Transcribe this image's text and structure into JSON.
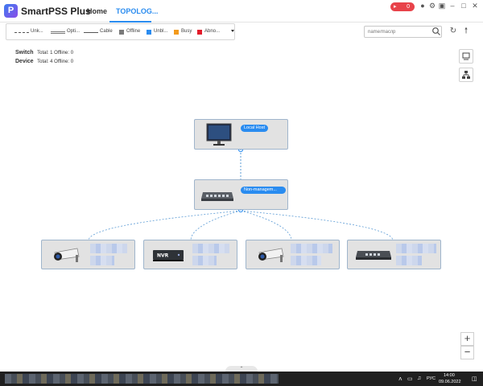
{
  "app": {
    "name": "SmartPSS Plus",
    "logo_letter": "P"
  },
  "tabs": [
    {
      "label": "Home"
    },
    {
      "label": "TOPOLOG..."
    }
  ],
  "titlebar": {
    "alarm_count": "0"
  },
  "legend": {
    "items": [
      "Unk...",
      "Opti...",
      "Cable",
      "Offline",
      "Unbl...",
      "Busy",
      "Abno..."
    ],
    "colors": {
      "offline": "#7a7a7a",
      "unblocked": "#2a8cf0",
      "busy": "#f39a1c",
      "abnormal": "#e21b2a"
    }
  },
  "search": {
    "placeholder": "name/mac/ip"
  },
  "stats": {
    "switch": {
      "label": "Switch",
      "total": "Total: 1",
      "offline": "Offline: 0"
    },
    "device": {
      "label": "Device",
      "total": "Total: 4",
      "offline": "Offline: 0"
    }
  },
  "nodes": {
    "local_host": {
      "badge": "Local Host",
      "icon": "monitor-icon"
    },
    "switch": {
      "badge": "Non-managem...",
      "icon": "switch-icon"
    },
    "devices": [
      {
        "icon": "camera-icon"
      },
      {
        "icon": "nvr-icon",
        "device_label": "NVR"
      },
      {
        "icon": "camera-icon"
      },
      {
        "icon": "switch-icon"
      }
    ]
  },
  "zoom": {
    "in": "+",
    "out": "−"
  },
  "taskbar": {
    "lang": "РУС",
    "time": "14:00",
    "date": "09.06.2022"
  }
}
